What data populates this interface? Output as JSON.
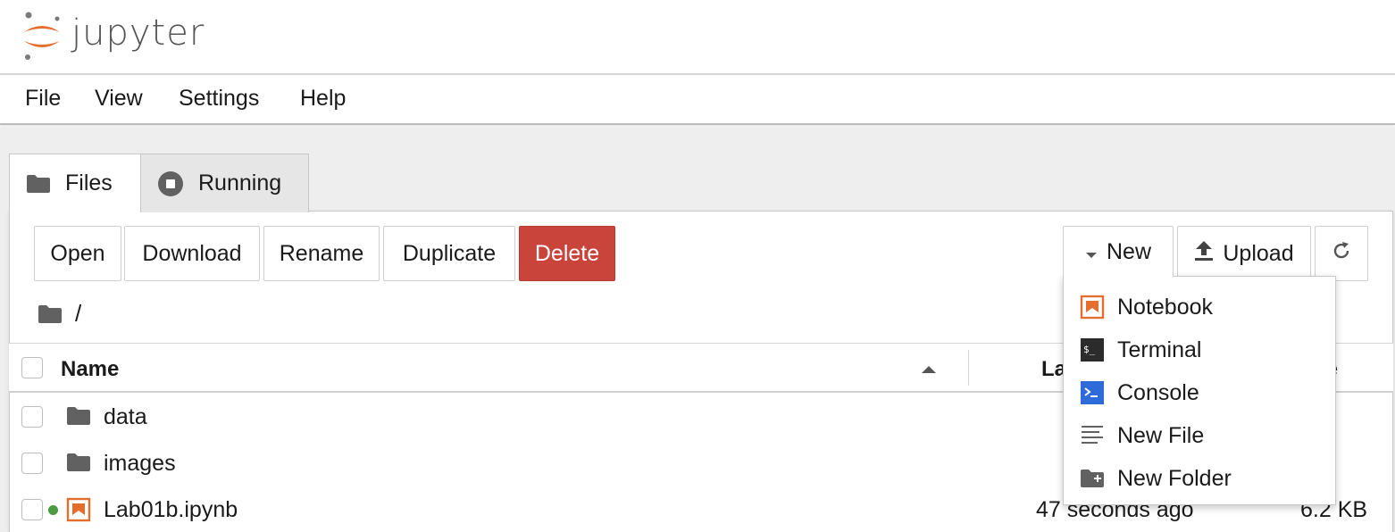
{
  "app": {
    "brand": "jupyter",
    "brand_color": "#e46e2e"
  },
  "menubar": {
    "items": [
      {
        "label": "File"
      },
      {
        "label": "View"
      },
      {
        "label": "Settings"
      },
      {
        "label": "Help"
      }
    ]
  },
  "tabs": [
    {
      "label": "Files",
      "icon": "folder-icon",
      "active": true
    },
    {
      "label": "Running",
      "icon": "stop-circle-icon",
      "active": false
    }
  ],
  "toolbar": {
    "open_label": "Open",
    "download_label": "Download",
    "rename_label": "Rename",
    "duplicate_label": "Duplicate",
    "delete_label": "Delete",
    "new_label": "New",
    "upload_label": "Upload",
    "refresh_icon": "refresh-icon"
  },
  "breadcrumb": {
    "path": "/"
  },
  "table": {
    "columns": {
      "name": "Name",
      "last_modified": "La",
      "size": "ize"
    },
    "rows": [
      {
        "name": "data",
        "type": "folder",
        "modified": "",
        "size": ""
      },
      {
        "name": "images",
        "type": "folder",
        "modified": "",
        "size": ""
      },
      {
        "name": "Lab01b.ipynb",
        "type": "notebook",
        "modified": "47 seconds ago",
        "size": "6.2 KB",
        "running": true
      }
    ]
  },
  "new_menu": {
    "items": [
      {
        "label": "Notebook",
        "icon": "notebook-icon"
      },
      {
        "label": "Terminal",
        "icon": "terminal-icon"
      },
      {
        "label": "Console",
        "icon": "console-icon"
      },
      {
        "label": "New File",
        "icon": "text-file-icon"
      },
      {
        "label": "New Folder",
        "icon": "new-folder-icon"
      }
    ]
  },
  "colors": {
    "delete": "#c9443a",
    "notebook_orange": "#e46e2e",
    "console_blue": "#2f6ad9",
    "running_dot": "#4b9b43"
  }
}
